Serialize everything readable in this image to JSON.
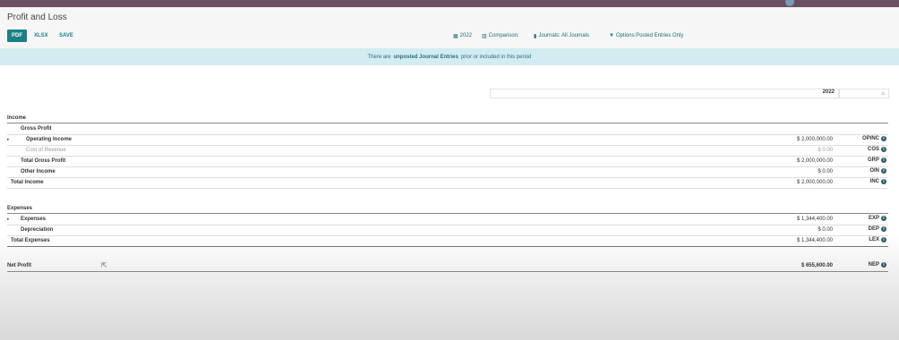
{
  "page": {
    "title": "Profit and Loss"
  },
  "toolbar": {
    "pdf_label": "PDF",
    "xlsx_label": "XLSX",
    "save_label": "SAVE"
  },
  "filters": {
    "date_label": "2022",
    "comparison_label": "Comparison:",
    "journals_label": "Journals: All Journals",
    "options_label": "Options:Posted Entries Only"
  },
  "alert": {
    "prefix": "There are",
    "emphasis": "unposted Journal Entries",
    "suffix": "prior or included in this period"
  },
  "report": {
    "column_header": "2022",
    "income_header": "Income",
    "expenses_header": "Expenses",
    "income_rows": [
      {
        "label": "Gross Profit",
        "amount": "",
        "code": ""
      },
      {
        "label": "Operating Income",
        "amount": "$ 2,000,000.00",
        "code": "OPINC"
      },
      {
        "label": "Cost of Revenue",
        "amount": "$ 0.00",
        "code": "COS"
      },
      {
        "label": "Total Gross Profit",
        "amount": "$ 2,000,000.00",
        "code": "GRP"
      },
      {
        "label": "Other Income",
        "amount": "$ 0.00",
        "code": "OIN"
      },
      {
        "label": "Total Income",
        "amount": "$ 2,000,000.00",
        "code": "INC"
      }
    ],
    "expense_rows": [
      {
        "label": "Expenses",
        "amount": "$ 1,344,400.00",
        "code": "EXP"
      },
      {
        "label": "Depreciation",
        "amount": "$ 0.00",
        "code": "DEP"
      },
      {
        "label": "Total Expenses",
        "amount": "$ 1,344,400.00",
        "code": "LEX"
      }
    ],
    "net_profit": {
      "label": "Net Profit",
      "amount": "$ 655,600.00",
      "code": "NEP"
    }
  },
  "colors": {
    "topbar": "#6b4f62",
    "primary": "#1d7f86",
    "alert_bg": "#d2ecf1"
  }
}
